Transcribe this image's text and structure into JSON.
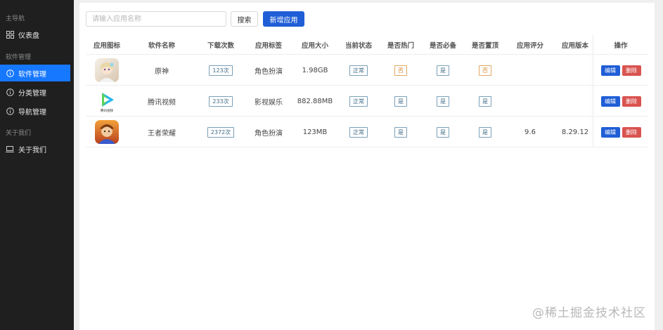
{
  "sidebar": {
    "groups": [
      {
        "label": "主导航"
      },
      {
        "label": "软件管理"
      },
      {
        "label": "关于我们"
      }
    ],
    "items": [
      {
        "label": "仪表盘",
        "icon": "grid-icon"
      },
      {
        "label": "软件管理",
        "icon": "info-icon",
        "active": true
      },
      {
        "label": "分类管理",
        "icon": "info-icon"
      },
      {
        "label": "导航管理",
        "icon": "info-icon"
      },
      {
        "label": "关于我们",
        "icon": "laptop-icon"
      }
    ]
  },
  "toolbar": {
    "search_placeholder": "请输入应用名称",
    "search_value": "",
    "search_label": "搜索",
    "add_label": "新增应用"
  },
  "table": {
    "headers": [
      "应用图标",
      "软件名称",
      "下载次数",
      "应用标签",
      "应用大小",
      "当前状态",
      "是否热门",
      "是否必备",
      "是否置顶",
      "应用评分",
      "应用版本",
      "操作"
    ],
    "rows": [
      {
        "icon": "genshin-app-icon",
        "name": "原神",
        "downloads": "123次",
        "tag": "角色扮演",
        "size": "1.98GB",
        "status": "正常",
        "hot": "否",
        "essential": "是",
        "top": "否",
        "rating": "",
        "version": "",
        "edit": "编辑",
        "delete": "删除"
      },
      {
        "icon": "tencent-video-app-icon",
        "icon_text": "腾讯视频",
        "name": "腾讯视频",
        "downloads": "233次",
        "tag": "影视娱乐",
        "size": "882.88MB",
        "status": "正常",
        "hot": "是",
        "essential": "是",
        "top": "是",
        "rating": "",
        "version": "",
        "edit": "编辑",
        "delete": "删除"
      },
      {
        "icon": "honor-of-kings-app-icon",
        "name": "王者荣耀",
        "downloads": "2372次",
        "tag": "角色扮演",
        "size": "123MB",
        "status": "正常",
        "hot": "是",
        "essential": "是",
        "top": "是",
        "rating": "9.6",
        "version": "8.29.12",
        "edit": "编辑",
        "delete": "删除"
      }
    ]
  },
  "watermark": "@稀土掘金技术社区",
  "colors": {
    "sidebar_bg": "#1f1f1f",
    "accent": "#1677ff",
    "primary_button": "#1f5ed6",
    "danger_button": "#d9534f",
    "tag_yes": "#3e6a87",
    "tag_no": "#d8862a"
  }
}
